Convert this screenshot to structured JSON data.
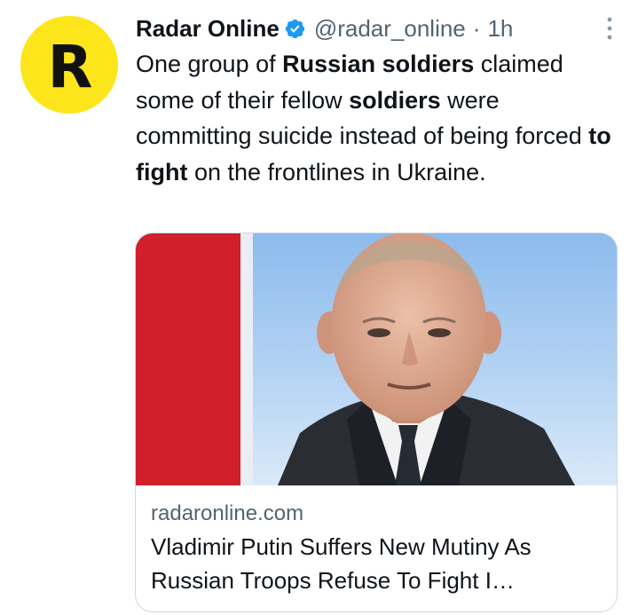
{
  "avatar": {
    "letter": "R",
    "bg_color": "#fce51b"
  },
  "header": {
    "display_name": "Radar Online",
    "verified_icon": "verified-badge-icon",
    "handle": "@radar_online",
    "separator": "·",
    "timestamp": "1h",
    "more_icon": "more-vertical-icon"
  },
  "tweet": {
    "segments": [
      {
        "text": "One group of ",
        "bold": false
      },
      {
        "text": "Russian soldiers",
        "bold": true
      },
      {
        "text": " claimed some of their fellow ",
        "bold": false
      },
      {
        "text": "soldiers",
        "bold": true
      },
      {
        "text": " were committing suicide instead of being forced ",
        "bold": false
      },
      {
        "text": "to fight",
        "bold": true
      },
      {
        "text": " on the frontlines in Ukraine.",
        "bold": false
      }
    ]
  },
  "card": {
    "domain": "radaronline.com",
    "title": "Vladimir Putin Suffers New Mutiny As Russian Troops Refuse To Fight I…"
  },
  "colors": {
    "verified": "#1d9bf0",
    "secondary_text": "#536471",
    "border": "#cfd9de"
  }
}
